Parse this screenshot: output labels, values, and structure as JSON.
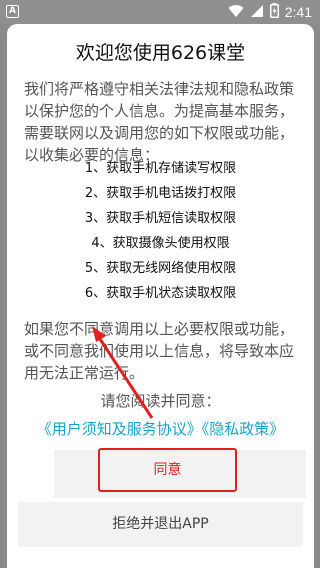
{
  "status_bar": {
    "app_icon_letter": "A",
    "time": "2:41"
  },
  "dialog": {
    "title": "欢迎您使用626课堂",
    "intro": "我们将严格遵守相关法律法规和隐私政策以保护您的个人信息。为提高基本服务，需要联网以及调用您的如下权限或功能，以收集必要的信息：",
    "permissions": [
      "1、获取手机存储读写权限",
      "2、获取手机电话拨打权限",
      "3、获取手机短信读取权限",
      "4、获取摄像头使用权限",
      "5、获取无线网络使用权限",
      "6、获取手机状态读取权限"
    ],
    "warning": "如果您不同意调用以上必要权限或功能，或不同意我们使用以上信息，将导致本应用无法正常运行。",
    "prompt": "请您阅读并同意：",
    "user_agreement_link": "《用户须知及服务协议》",
    "privacy_link": "《隐私政策》",
    "agree_button": "同意",
    "reject_button": "拒绝并退出APP"
  },
  "colors": {
    "link": "#1aa3c8",
    "highlight": "#e02020"
  }
}
